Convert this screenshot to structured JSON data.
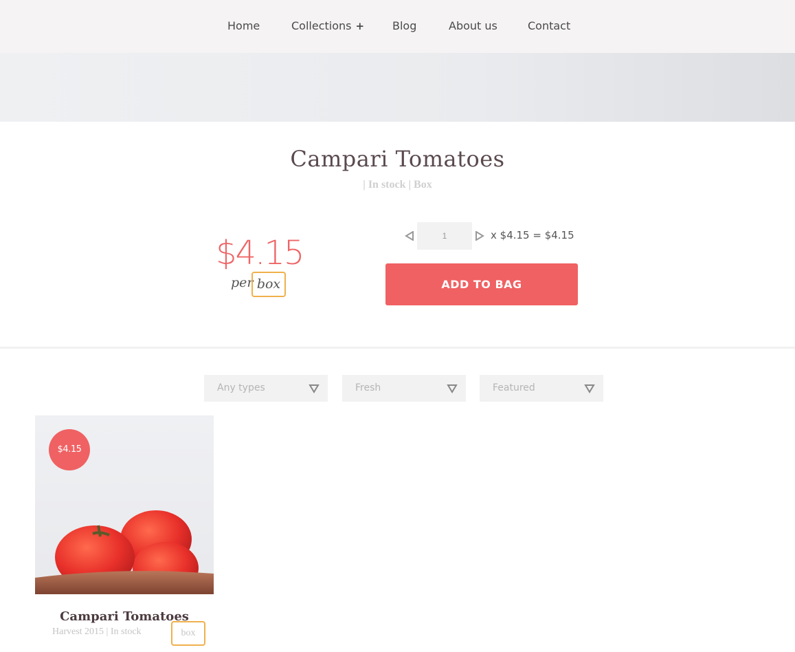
{
  "nav": {
    "items": [
      {
        "label": "Home"
      },
      {
        "label": "Collections",
        "expand": "+"
      },
      {
        "label": "Blog"
      },
      {
        "label": "About us"
      },
      {
        "label": "Contact"
      }
    ]
  },
  "product": {
    "title": "Campari Tomatoes",
    "meta": "| In stock | Box",
    "price": "$4.15",
    "per": "per",
    "unit": "box",
    "quantity": "1",
    "total": "x $4.15 = $4.15",
    "add_label": "ADD TO BAG"
  },
  "filters": [
    {
      "label": "Any types"
    },
    {
      "label": "Fresh"
    },
    {
      "label": "Featured"
    }
  ],
  "card": {
    "badge": "$4.15",
    "title": "Campari Tomatoes",
    "meta": "Harvest 2015  |  In stock",
    "unit": "box"
  },
  "icons": {
    "qty_decrease": "triangle-left-icon",
    "qty_increase": "triangle-right-icon",
    "filter_arrow": "triangle-down-icon"
  },
  "colors": {
    "accent": "#f06163",
    "unit_border": "#f0b04c",
    "nav_bg": "#f5f3f4"
  }
}
